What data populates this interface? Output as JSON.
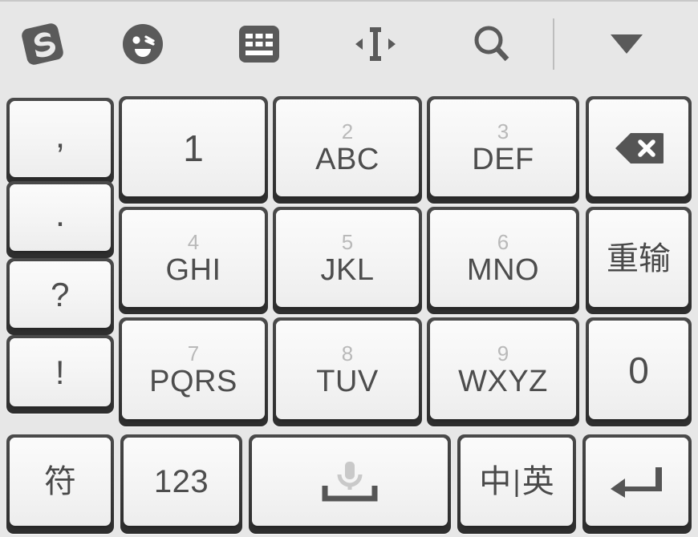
{
  "toolbar": {
    "items": [
      {
        "name": "sogou-logo-icon",
        "label": "Sogou"
      },
      {
        "name": "emoji-icon",
        "label": "Emoji"
      },
      {
        "name": "keyboard-icon",
        "label": "Keyboard"
      },
      {
        "name": "cursor-move-icon",
        "label": "Move cursor"
      },
      {
        "name": "search-icon",
        "label": "Search"
      },
      {
        "name": "collapse-keyboard-icon",
        "label": "Hide keyboard"
      }
    ]
  },
  "keyboard": {
    "left_column": [
      {
        "label": ",",
        "name": "key-comma"
      },
      {
        "label": ".",
        "name": "key-period"
      },
      {
        "label": "?",
        "name": "key-question"
      },
      {
        "label": "!",
        "name": "key-exclamation"
      }
    ],
    "numpad": [
      {
        "digit": "1",
        "letters": "",
        "name": "key-1"
      },
      {
        "digit": "2",
        "letters": "ABC",
        "name": "key-2-abc"
      },
      {
        "digit": "3",
        "letters": "DEF",
        "name": "key-3-def"
      },
      {
        "digit": "4",
        "letters": "GHI",
        "name": "key-4-ghi"
      },
      {
        "digit": "5",
        "letters": "JKL",
        "name": "key-5-jkl"
      },
      {
        "digit": "6",
        "letters": "MNO",
        "name": "key-6-mno"
      },
      {
        "digit": "7",
        "letters": "PQRS",
        "name": "key-7-pqrs"
      },
      {
        "digit": "8",
        "letters": "TUV",
        "name": "key-8-tuv"
      },
      {
        "digit": "9",
        "letters": "WXYZ",
        "name": "key-9-wxyz"
      }
    ],
    "right_column": [
      {
        "label": "",
        "name": "key-backspace",
        "icon": "backspace-icon"
      },
      {
        "label": "重输",
        "name": "key-reinput"
      },
      {
        "label": "0",
        "name": "key-0"
      }
    ],
    "bottom_row": [
      {
        "label": "符",
        "name": "key-symbols"
      },
      {
        "label": "123",
        "name": "key-123"
      },
      {
        "label": "",
        "name": "key-space",
        "icon": "space-mic-icon"
      },
      {
        "label": "中英",
        "name": "key-lang-toggle"
      },
      {
        "label": "",
        "name": "key-enter",
        "icon": "enter-icon"
      }
    ],
    "lang_toggle": {
      "cn": "中",
      "sep": "|",
      "en": "英"
    }
  },
  "colors": {
    "background": "#e7e7e7",
    "key_frame": "#3a3a3a",
    "keycap": "#f7f7f7",
    "label": "#4d4d4d",
    "digit_hint": "#b9b9b9",
    "icon": "#5a5a5a"
  }
}
